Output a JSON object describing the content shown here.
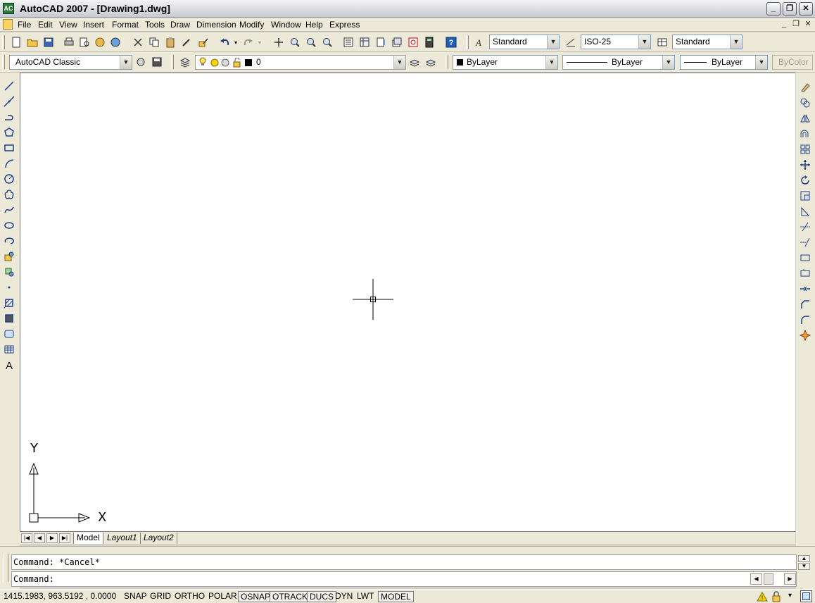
{
  "window": {
    "title": "AutoCAD 2007 - [Drawing1.dwg]",
    "app_icon_label": "AC"
  },
  "menus": [
    "File",
    "Edit",
    "View",
    "Insert",
    "Format",
    "Tools",
    "Draw",
    "Dimension",
    "Modify",
    "Window",
    "Help",
    "Express"
  ],
  "toolbar1": {
    "text_style": "Standard",
    "dim_style": "ISO-25",
    "table_style": "Standard"
  },
  "toolbar2": {
    "workspace": "AutoCAD Classic",
    "layer": "0",
    "color": "ByLayer",
    "linetype": "ByLayer",
    "lineweight": "ByLayer",
    "plotstyle": "ByColor"
  },
  "tabs": [
    "Model",
    "Layout1",
    "Layout2"
  ],
  "ucs": {
    "x_label": "X",
    "y_label": "Y"
  },
  "command": {
    "history": "Command: *Cancel*",
    "prompt": "Command:"
  },
  "status": {
    "coords": "1415.1983, 963.5192 , 0.0000",
    "toggles": [
      {
        "label": "SNAP",
        "on": false
      },
      {
        "label": "GRID",
        "on": false
      },
      {
        "label": "ORTHO",
        "on": false
      },
      {
        "label": "POLAR",
        "on": false
      },
      {
        "label": "OSNAP",
        "on": true
      },
      {
        "label": "OTRACK",
        "on": true
      },
      {
        "label": "DUCS",
        "on": true
      },
      {
        "label": "DYN",
        "on": false
      },
      {
        "label": "LWT",
        "on": false
      },
      {
        "label": "MODEL",
        "on": true
      }
    ]
  }
}
